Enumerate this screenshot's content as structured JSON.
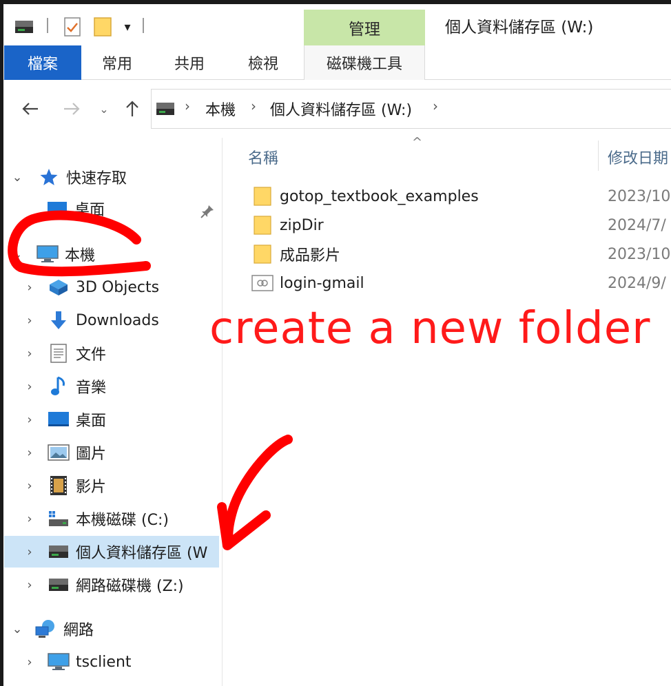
{
  "qat": {
    "title": "個人資料儲存區 (W:)",
    "manage_tab": "管理"
  },
  "ribbon": {
    "tabs": [
      "檔案",
      "常用",
      "共用",
      "檢視"
    ],
    "tools_tab": "磁碟機工具"
  },
  "address": {
    "crumbs": [
      "本機",
      "個人資料儲存區 (W:)"
    ]
  },
  "nav": {
    "quick_access": "快速存取",
    "quick_desktop": "桌面",
    "this_pc": "本機",
    "items": [
      {
        "label": "3D Objects",
        "icon": "3d-objects-icon"
      },
      {
        "label": "Downloads",
        "icon": "downloads-icon"
      },
      {
        "label": "文件",
        "icon": "documents-icon"
      },
      {
        "label": "音樂",
        "icon": "music-icon"
      },
      {
        "label": "桌面",
        "icon": "desktop-icon"
      },
      {
        "label": "圖片",
        "icon": "pictures-icon"
      },
      {
        "label": "影片",
        "icon": "videos-icon"
      },
      {
        "label": "本機磁碟 (C:)",
        "icon": "local-disk-icon"
      },
      {
        "label": "個人資料儲存區 (W",
        "icon": "network-drive-icon"
      },
      {
        "label": "網路磁碟機 (Z:)",
        "icon": "network-drive-icon"
      }
    ],
    "network": "網路",
    "tsclient": "tsclient"
  },
  "columns": {
    "name": "名稱",
    "date": "修改日期"
  },
  "files": [
    {
      "name": "gotop_textbook_examples",
      "date": "2023/10",
      "icon": "folder-icon"
    },
    {
      "name": "zipDir",
      "date": "2024/7/",
      "icon": "folder-icon"
    },
    {
      "name": "成品影片",
      "date": "2023/10",
      "icon": "folder-icon"
    },
    {
      "name": "login-gmail",
      "date": "2024/9/",
      "icon": "shortcut-file-icon"
    }
  ],
  "annotation": {
    "text": "create a new folder",
    "color": "#ff1a1a"
  },
  "colors": {
    "file_tab": "#1a64c8",
    "manage_tab": "#c8e6a8",
    "selected": "#cce4f7"
  }
}
